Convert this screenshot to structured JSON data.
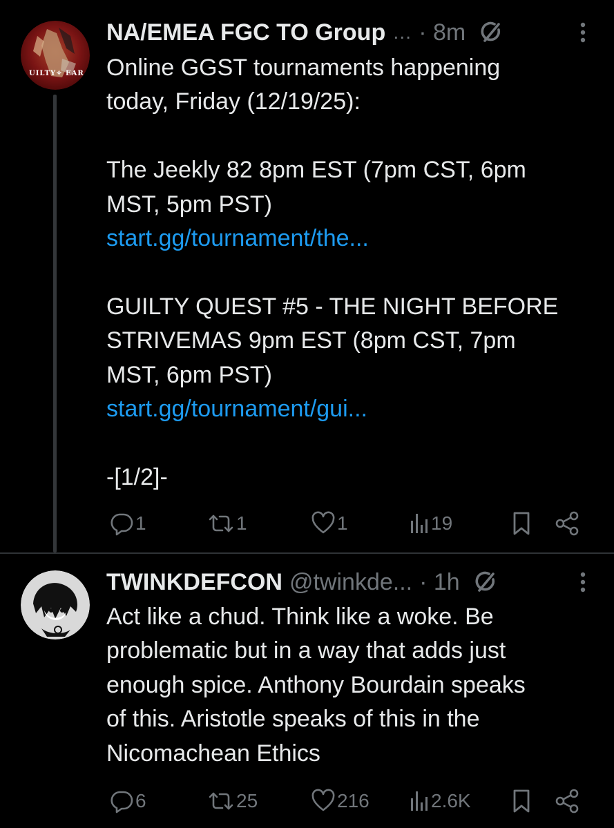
{
  "tweets": [
    {
      "name": "NA/EMEA FGC TO Group",
      "handle": "",
      "ellipsis": "…",
      "time": "· 8m",
      "avatar_text": "UILTY✧ EAR",
      "lines": [
        "Online GGST tournaments happening",
        "today, Friday (12/19/25):",
        "",
        "The Jeekly 82 8pm EST (7pm CST, 6pm",
        "MST, 5pm PST)"
      ],
      "link1": "start.gg/tournament/the...",
      "lines2": [
        "",
        "GUILTY QUEST #5 - THE NIGHT BEFORE",
        "STRIVEMAS 9pm EST (8pm CST, 7pm",
        "MST, 6pm PST)"
      ],
      "link2": "start.gg/tournament/gui...",
      "footer": "-[1/2]-",
      "stats": {
        "replies": "1",
        "reposts": "1",
        "likes": "1",
        "views": "19"
      }
    },
    {
      "name": "TWINKDEFCON",
      "handle": "@twinkde...",
      "time": "· 1h",
      "lines": [
        "Act like a chud. Think like a woke. Be",
        "problematic but in a way that adds just",
        "enough spice. Anthony Bourdain speaks",
        "of this. Aristotle speaks of this in the",
        "Nicomachean Ethics"
      ],
      "stats": {
        "replies": "6",
        "reposts": "25",
        "likes": "216",
        "views": "2.6K"
      }
    }
  ],
  "icons": {
    "reply": "reply-icon",
    "repost": "repost-icon",
    "like": "like-icon",
    "views": "views-icon",
    "bookmark": "bookmark-icon",
    "share": "share-icon",
    "grok": "grok-icon",
    "more": "more-icon"
  },
  "colors": {
    "background": "#000000",
    "text": "#e7e9ea",
    "muted": "#71767b",
    "link": "#1d9bf0"
  }
}
